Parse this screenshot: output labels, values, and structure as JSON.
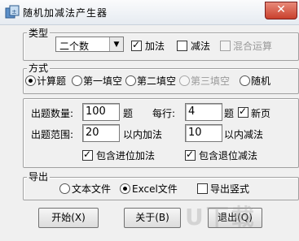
{
  "window": {
    "title": "随机加减法产生器",
    "close": "✕"
  },
  "type_group": {
    "legend": "类型",
    "select_value": "二个数",
    "options": [
      {
        "label": "加法",
        "checked": true,
        "disabled": false
      },
      {
        "label": "减法",
        "checked": false,
        "disabled": false
      },
      {
        "label": "混合运算",
        "checked": false,
        "disabled": true
      }
    ]
  },
  "mode_group": {
    "legend": "方式",
    "options": [
      {
        "label": "计算题",
        "checked": true,
        "disabled": false
      },
      {
        "label": "第一填空",
        "checked": false,
        "disabled": false
      },
      {
        "label": "第二填空",
        "checked": false,
        "disabled": false
      },
      {
        "label": "第三填空",
        "checked": false,
        "disabled": true
      },
      {
        "label": "随机",
        "checked": false,
        "disabled": false
      }
    ]
  },
  "settings": {
    "count_label": "出题数量:",
    "count_value": "100",
    "count_unit": "题",
    "per_row_label": "每行:",
    "per_row_value": "4",
    "per_row_unit": "题",
    "new_page_label": "新页",
    "new_page_checked": true,
    "range_label": "出题范围:",
    "add_range_value": "20",
    "add_range_unit": "以内加法",
    "sub_range_value": "10",
    "sub_range_unit": "以内减法",
    "carry_label": "包含进位加法",
    "carry_checked": true,
    "borrow_label": "包含退位减法",
    "borrow_checked": true
  },
  "export_group": {
    "legend": "导出",
    "text_label": "文本文件",
    "text_checked": false,
    "excel_label": "Excel文件",
    "excel_checked": true,
    "vertical_label": "导出竖式",
    "vertical_checked": false
  },
  "buttons": {
    "start": "开始(X)",
    "about": "关于(B)",
    "exit": "退出(Q)"
  },
  "watermark": "U下载"
}
